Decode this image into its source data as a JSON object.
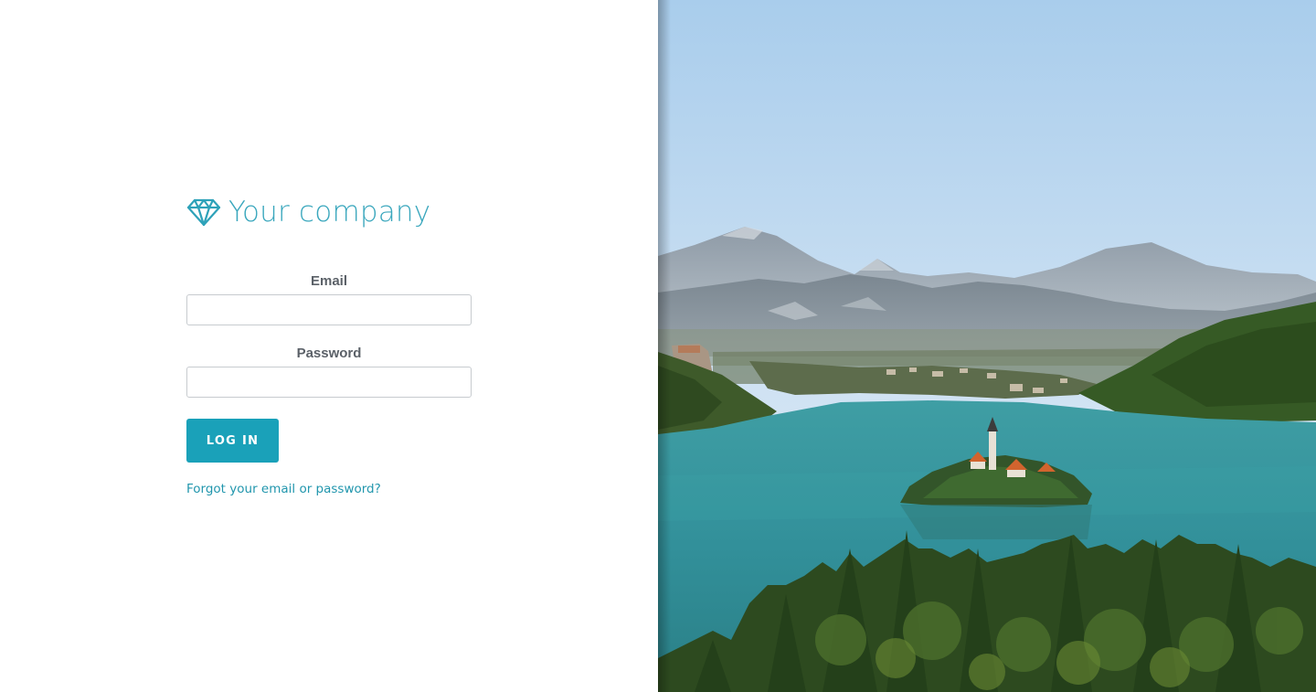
{
  "brand": {
    "name": "Your company",
    "icon": "diamond-icon",
    "color": "#3aa7bd"
  },
  "login_form": {
    "email_label": "Email",
    "email_value": "",
    "password_label": "Password",
    "password_value": "",
    "login_button_label": "LOG IN",
    "forgot_link_label": "Forgot your email or password?"
  },
  "colors": {
    "accent": "#1aa1b9",
    "link": "#2196ad",
    "label": "#5b6168"
  }
}
